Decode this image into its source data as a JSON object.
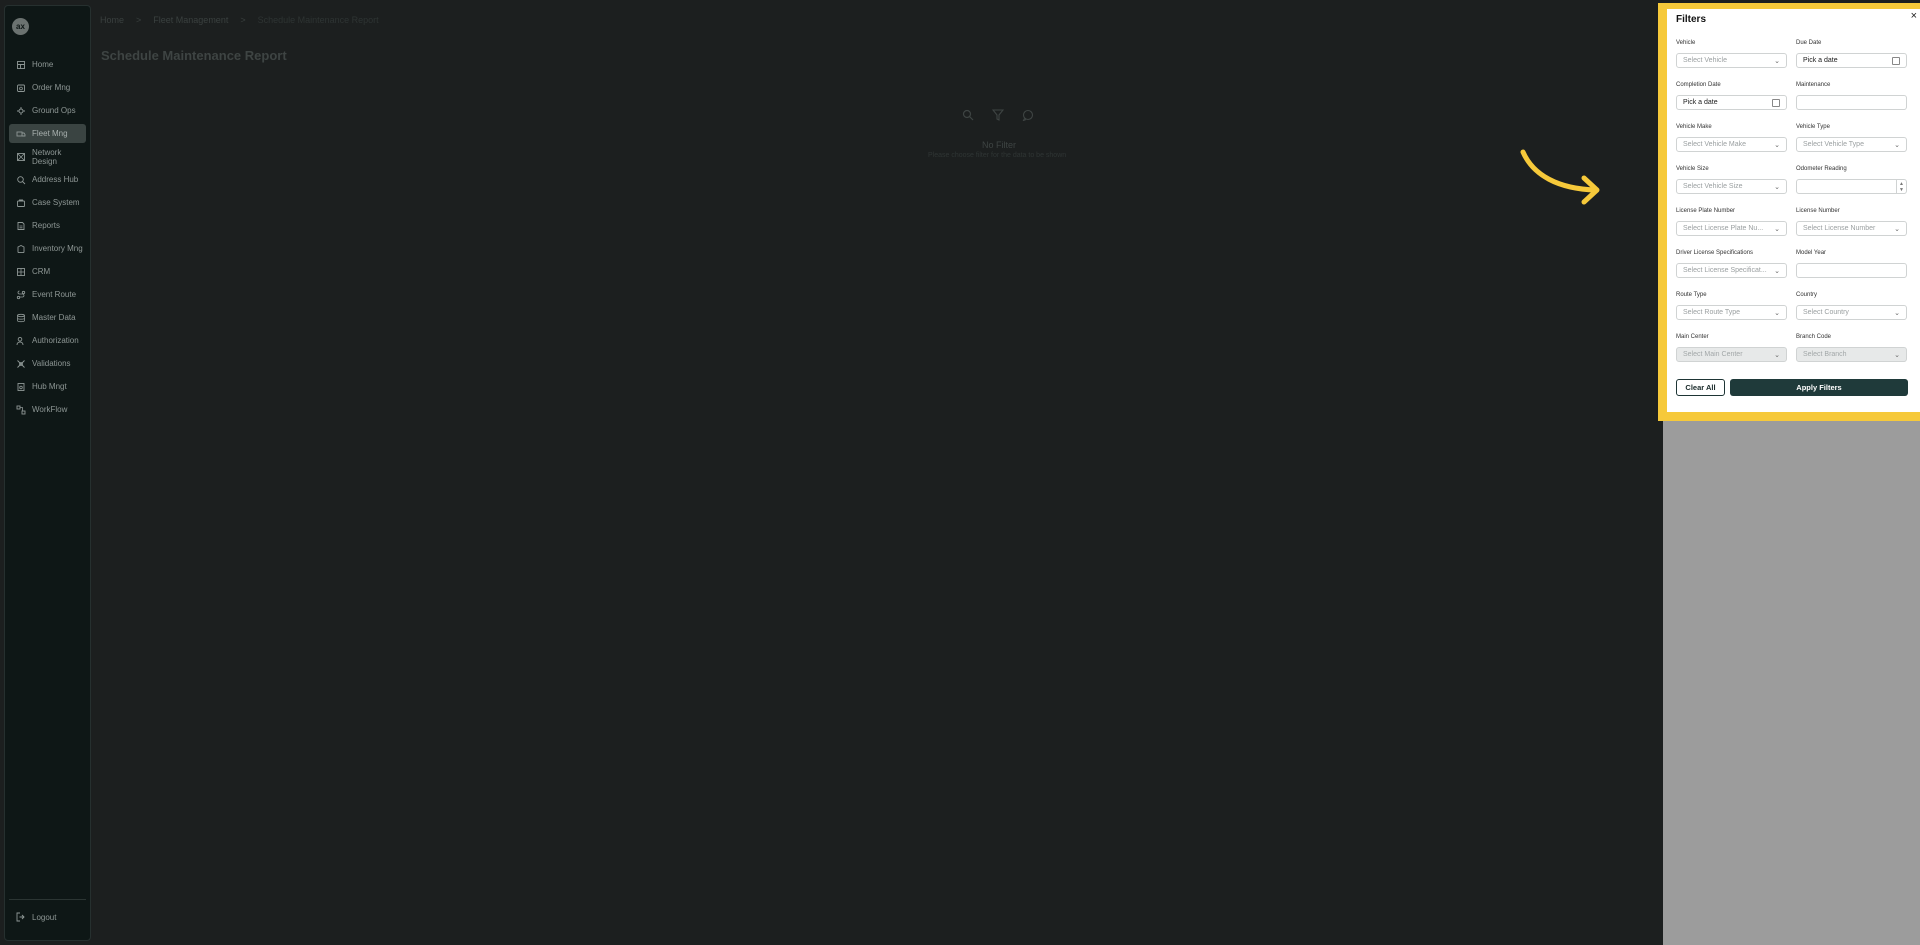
{
  "sidebar": {
    "logo_text": "ax",
    "items": [
      {
        "label": "Home",
        "icon": "home-icon",
        "active": false
      },
      {
        "label": "Order Mng",
        "icon": "order-icon",
        "active": false
      },
      {
        "label": "Ground Ops",
        "icon": "ground-ops-icon",
        "active": false
      },
      {
        "label": "Fleet Mng",
        "icon": "truck-icon",
        "active": true
      },
      {
        "label": "Network Design",
        "icon": "network-icon",
        "active": false
      },
      {
        "label": "Address Hub",
        "icon": "address-icon",
        "active": false
      },
      {
        "label": "Case System",
        "icon": "case-icon",
        "active": false
      },
      {
        "label": "Reports",
        "icon": "report-icon",
        "active": false
      },
      {
        "label": "Inventory Mng",
        "icon": "inventory-icon",
        "active": false
      },
      {
        "label": "CRM",
        "icon": "crm-icon",
        "active": false
      },
      {
        "label": "Event Route",
        "icon": "route-icon",
        "active": false
      },
      {
        "label": "Master Data",
        "icon": "database-icon",
        "active": false
      },
      {
        "label": "Authorization",
        "icon": "user-key-icon",
        "active": false
      },
      {
        "label": "Validations",
        "icon": "validation-icon",
        "active": false
      },
      {
        "label": "Hub Mngt",
        "icon": "hub-icon",
        "active": false
      },
      {
        "label": "WorkFlow",
        "icon": "workflow-icon",
        "active": false
      }
    ],
    "logout_label": "Logout"
  },
  "breadcrumb": {
    "home": "Home",
    "section": "Fleet Management",
    "current": "Schedule Maintenance Report"
  },
  "page": {
    "title": "Schedule Maintenance Report",
    "empty_title": "No Filter",
    "empty_subtitle": "Please choose filter for the data to be shown"
  },
  "filters": {
    "title": "Filters",
    "close_glyph": "×",
    "fields": {
      "vehicle": {
        "label": "Vehicle",
        "placeholder": "Select Vehicle"
      },
      "due_date": {
        "label": "Due Date",
        "placeholder": "Pick a date"
      },
      "completion_date": {
        "label": "Completion Date",
        "placeholder": "Pick a date"
      },
      "maintenance": {
        "label": "Maintenance",
        "value": ""
      },
      "vehicle_make": {
        "label": "Vehicle Make",
        "placeholder": "Select Vehicle Make"
      },
      "vehicle_type": {
        "label": "Vehicle Type",
        "placeholder": "Select Vehicle Type"
      },
      "vehicle_size": {
        "label": "Vehicle Size",
        "placeholder": "Select Vehicle Size"
      },
      "odometer": {
        "label": "Odometer Reading",
        "value": ""
      },
      "license_plate": {
        "label": "License Plate Number",
        "placeholder": "Select License Plate Nu..."
      },
      "license_number": {
        "label": "License Number",
        "placeholder": "Select License Number"
      },
      "driver_license": {
        "label": "Driver License Specifications",
        "placeholder": "Select License Specificat..."
      },
      "model_year": {
        "label": "Model Year",
        "value": ""
      },
      "route_type": {
        "label": "Route Type",
        "placeholder": "Select Route Type"
      },
      "country": {
        "label": "Country",
        "placeholder": "Select Country"
      },
      "main_center": {
        "label": "Main Center",
        "placeholder": "Select Main Center"
      },
      "branch_code": {
        "label": "Branch Code",
        "placeholder": "Select Branch"
      }
    },
    "clear_label": "Clear All",
    "apply_label": "Apply Filters"
  },
  "colors": {
    "highlight": "#f6c93a",
    "primary": "#1f3a3a"
  }
}
